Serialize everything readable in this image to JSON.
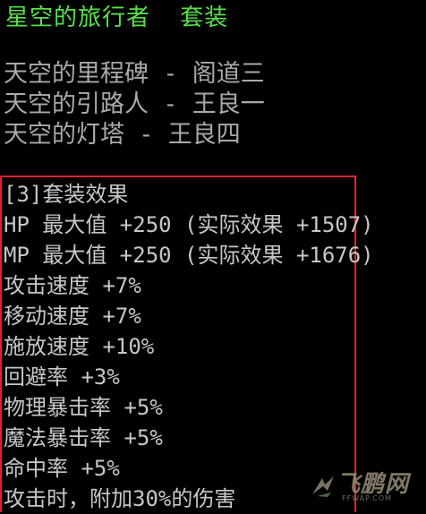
{
  "tooltip": {
    "set_title": "星空的旅行者  套装",
    "set_items": [
      "天空的里程碑 - 阁道三",
      "天空的引路人 - 王良一",
      "天空的灯塔 - 王良四"
    ],
    "effects": [
      "[3]套装效果",
      "HP 最大值 +250 (实际效果 +1507)",
      "MP 最大值 +250 (实际效果 +1676)",
      "攻击速度 +7%",
      "移动速度 +7%",
      "施放速度 +10%",
      "回避率 +3%",
      "物理暴击率 +5%",
      "魔法暴击率 +5%",
      "命中率 +5%",
      "攻击时，附加30%的伤害"
    ]
  },
  "watermark": {
    "text": "飞鹏网",
    "url": "FFWAP.COM"
  },
  "colors": {
    "background": "#000000",
    "title": "#58e04a",
    "set_item": "#a9a9a9",
    "effect": "#c7c7c7",
    "highlight_border": "#e0232f"
  },
  "icons": {
    "watermark_logo": "bird-logo-icon"
  }
}
